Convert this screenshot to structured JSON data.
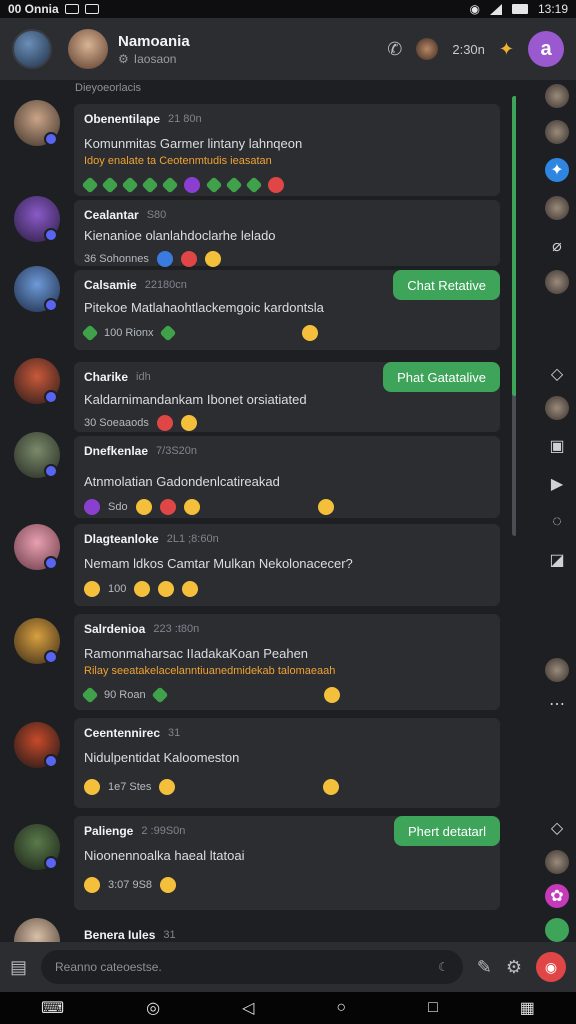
{
  "status_bar": {
    "left_text": "00 Onnia",
    "time": "13:19"
  },
  "header": {
    "title": "Namoania",
    "subtitle": "Iaosaon",
    "count": "2:30n",
    "main_icon": "a"
  },
  "topline": "Dieyoeorlacis",
  "messages": [
    {
      "name": "Obenentilape",
      "time": "21 80n",
      "text": "Komunmitas Garmer lintany lahnqeon",
      "sub": "Idoy enalate ta Ceotenmtudis ieasatan",
      "reactions": "",
      "chat_button": ""
    },
    {
      "name": "Cealantar",
      "time": "S80",
      "text": "Kienanioe olanlahdoclarhe lelado",
      "sub": "",
      "reactions": "36 Sohonnes",
      "chat_button": ""
    },
    {
      "name": "Calsamie",
      "time": "22180cn",
      "text": "Pitekoe Matlahaohtlackemgoic kardontsla",
      "sub": "",
      "reactions": "100 Rionx",
      "chat_button": "Chat Retative"
    },
    {
      "name": "Charike",
      "time": "idh",
      "text": "Kaldarnimandankam Ibonet orsiatiated",
      "sub": "",
      "reactions": "30 Soeaaods",
      "chat_button": "Phat Gatatalive"
    },
    {
      "name": "Dnefkenlae",
      "time": "7/3S20n",
      "text": "Atnmolatian Gadondenlcatireakad",
      "sub": "",
      "reactions": "Sdo",
      "chat_button": ""
    },
    {
      "name": "Dlagteanloke",
      "time": "2L1 ;8:60n",
      "text": "Nemam ldkos Camtar Mulkan Nekolonacecer?",
      "sub": "",
      "reactions": "100",
      "chat_button": ""
    },
    {
      "name": "Salrdenioa",
      "time": "223 :t80n",
      "text": "Ramonmaharsac IIadakaKoan Peahen",
      "sub": "Rilay seeatakelacelanntiuanedmidekab talomaeaah",
      "reactions": "90 Roan",
      "chat_button": ""
    },
    {
      "name": "Ceentennirec",
      "time": "31",
      "text": "Nidulpentidat Kaloomeston",
      "sub": "",
      "reactions": "1e7 Stes",
      "chat_button": ""
    },
    {
      "name": "Palienge",
      "time": "2 :99S0n",
      "text": "Nioonennoalka haeal ltatoai",
      "sub": "",
      "reactions": "3:07 9S8",
      "chat_button": "Phert detatarl"
    },
    {
      "name": "Benera Iules",
      "time": "31",
      "text": "",
      "sub": "",
      "reactions": "",
      "chat_button": ""
    }
  ],
  "composer": {
    "placeholder": "Reanno cateoestse."
  },
  "icons": [
    "back-avatar-icon",
    "phone-icon",
    "fire-icon",
    "search-icon",
    "send-icon",
    "edit-icon",
    "settings-icon"
  ],
  "colors": {
    "accent": "#9b59d0",
    "green": "#3da45a",
    "card": "#2b2d31",
    "bg": "#1e1f22",
    "highlight": "#f0a232"
  }
}
